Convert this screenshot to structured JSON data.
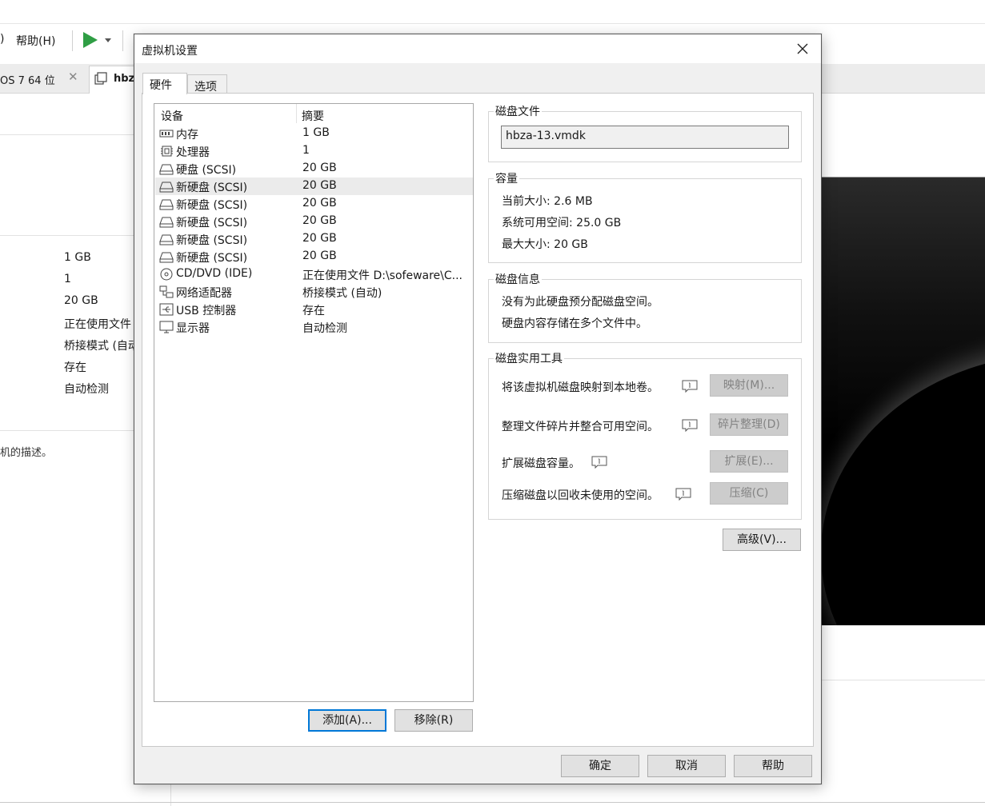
{
  "background": {
    "menu_paren": ")",
    "menu_help": "帮助(H)",
    "tabs": [
      {
        "label": "OS 7 64 位"
      },
      {
        "label": "hbza"
      }
    ],
    "summary_values": [
      "1 GB",
      "1",
      "20 GB",
      "正在使用文件",
      "桥接模式 (自动)",
      "存在",
      "自动检测"
    ],
    "description_hint": "机的描述。"
  },
  "dialog": {
    "title": "虚拟机设置",
    "tabs": {
      "hardware": "硬件",
      "options": "选项"
    },
    "device_list": {
      "col_device": "设备",
      "col_summary": "摘要",
      "rows": [
        {
          "name": "内存",
          "summary": "1 GB",
          "icon": "memory-icon"
        },
        {
          "name": "处理器",
          "summary": "1",
          "icon": "cpu-icon"
        },
        {
          "name": "硬盘 (SCSI)",
          "summary": "20 GB",
          "icon": "disk-icon"
        },
        {
          "name": "新硬盘 (SCSI)",
          "summary": "20 GB",
          "icon": "disk-icon",
          "selected": true
        },
        {
          "name": "新硬盘 (SCSI)",
          "summary": "20 GB",
          "icon": "disk-icon"
        },
        {
          "name": "新硬盘 (SCSI)",
          "summary": "20 GB",
          "icon": "disk-icon"
        },
        {
          "name": "新硬盘 (SCSI)",
          "summary": "20 GB",
          "icon": "disk-icon"
        },
        {
          "name": "新硬盘 (SCSI)",
          "summary": "20 GB",
          "icon": "disk-icon"
        },
        {
          "name": "CD/DVD (IDE)",
          "summary": "正在使用文件 D:\\sofeware\\C...",
          "icon": "cd-icon"
        },
        {
          "name": "网络适配器",
          "summary": "桥接模式 (自动)",
          "icon": "network-icon"
        },
        {
          "name": "USB 控制器",
          "summary": "存在",
          "icon": "usb-icon"
        },
        {
          "name": "显示器",
          "summary": "自动检测",
          "icon": "monitor-icon"
        }
      ]
    },
    "add_button": "添加(A)...",
    "remove_button": "移除(R)",
    "disk_file": {
      "title": "磁盘文件",
      "value": "hbza-13.vmdk"
    },
    "capacity": {
      "title": "容量",
      "current_size": "当前大小: 2.6 MB",
      "free_space": "系统可用空间: 25.0 GB",
      "max_size": "最大大小: 20 GB"
    },
    "disk_info": {
      "title": "磁盘信息",
      "line1": "没有为此硬盘预分配磁盘空间。",
      "line2": "硬盘内容存储在多个文件中。"
    },
    "disk_utilities": {
      "title": "磁盘实用工具",
      "map_text": "将该虚拟机磁盘映射到本地卷。",
      "map_button": "映射(M)...",
      "defrag_text": "整理文件碎片并整合可用空间。",
      "defrag_button": "碎片整理(D)",
      "expand_text": "扩展磁盘容量。",
      "expand_button": "扩展(E)...",
      "compact_text": "压缩磁盘以回收未使用的空间。",
      "compact_button": "压缩(C)"
    },
    "advanced_button": "高级(V)...",
    "ok_button": "确定",
    "cancel_button": "取消",
    "help_button": "帮助"
  }
}
